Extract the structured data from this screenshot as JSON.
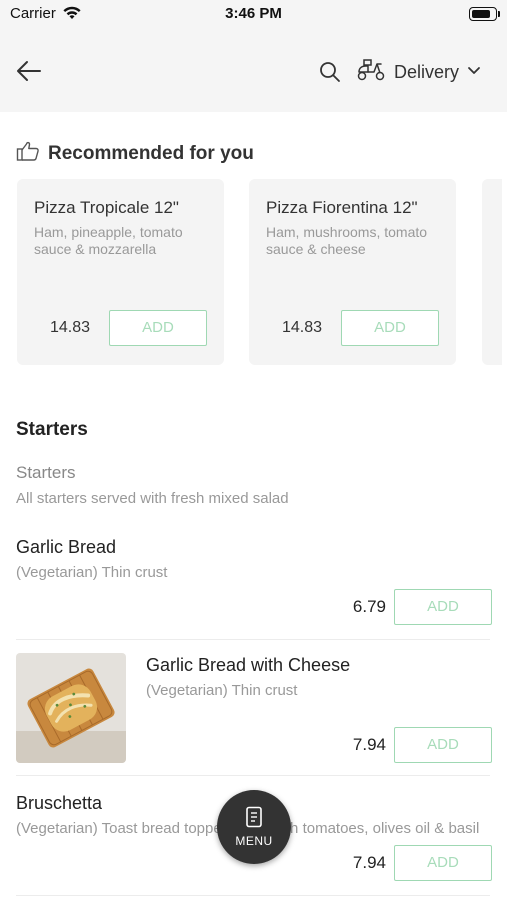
{
  "status_bar": {
    "carrier": "Carrier",
    "time": "3:46 PM"
  },
  "header": {
    "delivery_label": "Delivery"
  },
  "recommended": {
    "title": "Recommended for you",
    "items": [
      {
        "name": "Pizza Tropicale 12\"",
        "description": "Ham, pineapple, tomato sauce & mozzarella",
        "price": "14.83",
        "add_label": "ADD"
      },
      {
        "name": "Pizza Fiorentina 12\"",
        "description": "Ham, mushrooms, tomato sauce & cheese",
        "price": "14.83",
        "add_label": "ADD"
      }
    ]
  },
  "section": {
    "title": "Starters",
    "subtitle": "Starters",
    "description": "All starters served with fresh mixed salad"
  },
  "items": [
    {
      "name": "Garlic Bread",
      "description": "(Vegetarian) Thin crust",
      "price": "6.79",
      "add_label": "ADD"
    },
    {
      "name": "Garlic Bread with Cheese",
      "description": "(Vegetarian) Thin crust",
      "price": "7.94",
      "add_label": "ADD"
    },
    {
      "name": "Bruschetta",
      "description": "(Vegetarian) Toast bread topped with fresh tomatoes, olives oil & basil",
      "price": "7.94",
      "add_label": "ADD"
    }
  ],
  "menu_fab": {
    "label": "MENU"
  },
  "colors": {
    "accent": "#a8dcba",
    "header_bg": "#f5f5f5",
    "card_bg": "#f4f4f4",
    "fab_bg": "#333333"
  }
}
